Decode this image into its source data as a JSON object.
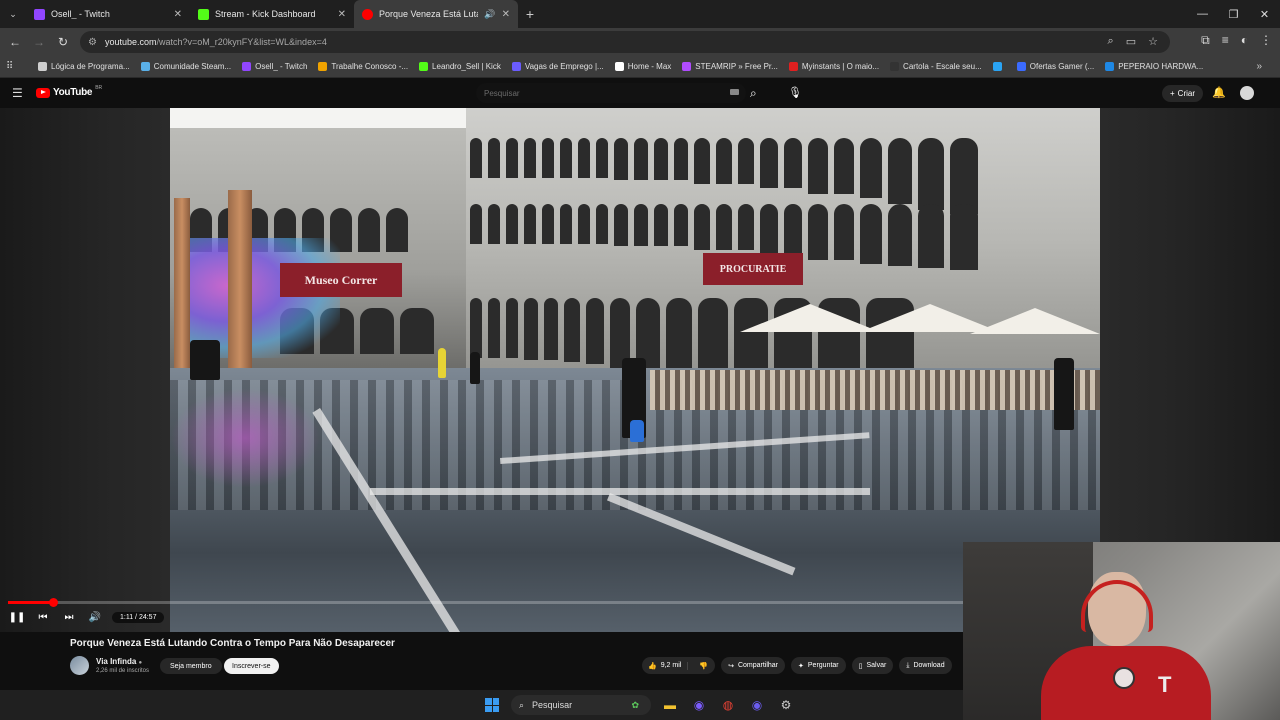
{
  "browser": {
    "tabs": [
      {
        "title": "Osell_ - Twitch",
        "favicon_color": "#9146ff",
        "active": false
      },
      {
        "title": "Stream - Kick Dashboard",
        "favicon_color": "#53fc18",
        "active": false
      },
      {
        "title": "Porque Veneza Está Lutand",
        "favicon_color": "#ff0000",
        "active": true
      }
    ],
    "url_host": "youtube.com",
    "url_rest": "/watch?v=oM_r20kynFY&list=WL&index=4",
    "bookmarks": [
      {
        "label": "Lógica de Programa...",
        "color": "#cfcfcf"
      },
      {
        "label": "Comunidade Steam...",
        "color": "#5ab0e8"
      },
      {
        "label": "Osell_ - Twitch",
        "color": "#9146ff"
      },
      {
        "label": "Trabalhe Conosco -...",
        "color": "#f0a300"
      },
      {
        "label": "Leandro_Sell | Kick",
        "color": "#53fc18"
      },
      {
        "label": "Vagas de Emprego |...",
        "color": "#6b5cff"
      },
      {
        "label": "Home - Max",
        "color": "#ffffff"
      },
      {
        "label": "STEAMRIP » Free Pr...",
        "color": "#b04cff"
      },
      {
        "label": "Myinstants | O maio...",
        "color": "#e02020"
      },
      {
        "label": "Cartola - Escale seu...",
        "color": "#333333"
      },
      {
        "label": "",
        "color": "#2aa4f4"
      },
      {
        "label": "Ofertas Gamer (...",
        "color": "#3b6bff"
      },
      {
        "label": "PEPERAIO HARDWA...",
        "color": "#1e88e5"
      }
    ]
  },
  "youtube": {
    "logo_text": "YouTube",
    "logo_country": "BR",
    "search_placeholder": "Pesquisar",
    "create_label": "Criar"
  },
  "video": {
    "sign_left": "Museo Correr",
    "sign_right": "PROCURATIE",
    "time": "1:11 / 24:57",
    "progress": 0.0474,
    "title": "Porque Veneza Está Lutando Contra o Tempo Para Não Desaparecer",
    "channel": "Via Infinda",
    "subscribers": "2,26 mil de inscritos",
    "join_label": "Seja membro",
    "subscribe_label": "Inscrever-se",
    "likes": "9,2 mil",
    "share_label": "Compartilhar",
    "ask_label": "Perguntar",
    "save_label": "Salvar",
    "download_label": "Download"
  },
  "taskbar": {
    "search_label": "Pesquisar"
  }
}
